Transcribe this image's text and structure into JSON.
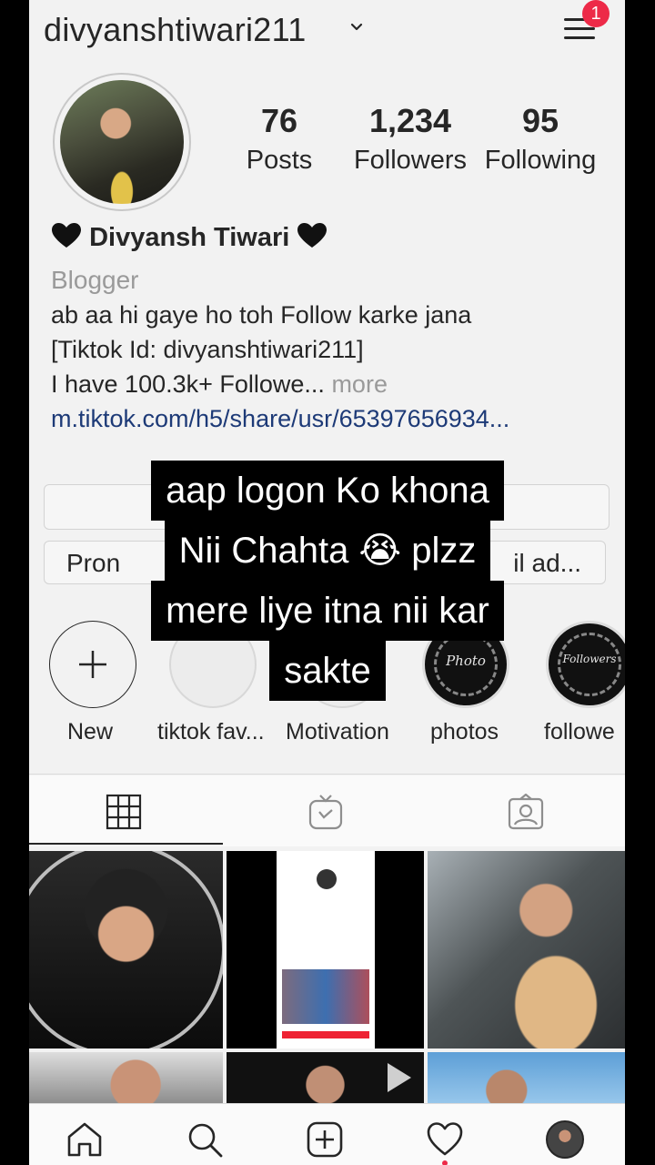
{
  "header": {
    "username": "divyanshtiwari211",
    "notification_count": "1"
  },
  "stats": [
    {
      "value": "76",
      "label": "Posts"
    },
    {
      "value": "1,234",
      "label": "Followers"
    },
    {
      "value": "95",
      "label": "Following"
    }
  ],
  "bio": {
    "name": "Divyansh Tiwari",
    "category": "Blogger",
    "line1": "ab aa hi gaye ho toh Follow karke jana",
    "line2": "[Tiktok Id: divyanshtiwari211]",
    "line3": "I have 100.3k+ Followe...",
    "more": " more",
    "link": "m.tiktok.com/h5/share/usr/65397656934..."
  },
  "buttons": {
    "promotions": "Pron",
    "email": "il ad..."
  },
  "highlights": [
    {
      "label": "New"
    },
    {
      "label": "tiktok fav..."
    },
    {
      "label": "Motivation"
    },
    {
      "label": "photos",
      "cover_text": "Photo"
    },
    {
      "label": "followe",
      "cover_text": "Followers"
    }
  ],
  "caption": {
    "lines": [
      "aap logon Ko khona",
      "Nii Chahta 😭 plzz",
      "mere liye itna nii kar",
      "sakte"
    ]
  },
  "colors": {
    "accent_red": "#ed2a48",
    "link_blue": "#1d3a77",
    "muted_gray": "#9a9a9a"
  },
  "icons": {
    "tabs": [
      "grid-icon",
      "igtv-icon",
      "tagged-icon"
    ],
    "nav": [
      "home-icon",
      "search-icon",
      "add-post-icon",
      "heart-icon",
      "profile-avatar"
    ]
  }
}
